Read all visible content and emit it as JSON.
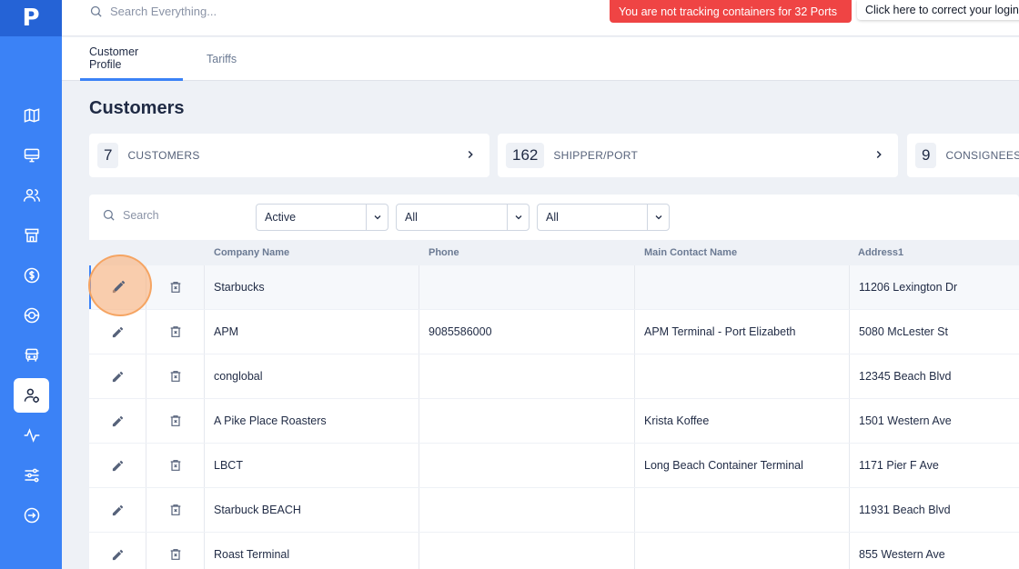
{
  "app": {
    "logo": "P"
  },
  "sidebar": {
    "items": [
      {
        "icon": "map-icon",
        "active": false
      },
      {
        "icon": "monitor-icon",
        "active": false
      },
      {
        "icon": "users-icon",
        "active": false
      },
      {
        "icon": "store-icon",
        "active": false
      },
      {
        "icon": "dollar-icon",
        "active": false
      },
      {
        "icon": "globe-icon",
        "active": false
      },
      {
        "icon": "truck-icon",
        "active": false
      },
      {
        "icon": "user-settings-icon",
        "active": true
      },
      {
        "icon": "activity-icon",
        "active": false
      },
      {
        "icon": "sliders-icon",
        "active": false
      },
      {
        "icon": "logout-icon",
        "active": false
      }
    ]
  },
  "topbar": {
    "search_placeholder": "Search Everything...",
    "alert_text": "You are not tracking containers for 32 Ports",
    "alert_button": "Click here to correct your login",
    "alert_color": "#ef4444"
  },
  "tabs": [
    {
      "label": "Customer Profile",
      "active": true
    },
    {
      "label": "Tariffs",
      "active": false
    }
  ],
  "page": {
    "title": "Customers"
  },
  "summary": [
    {
      "count": "7",
      "label": "CUSTOMERS"
    },
    {
      "count": "162",
      "label": "SHIPPER/PORT"
    },
    {
      "count": "9",
      "label": "CONSIGNEES"
    }
  ],
  "filters": {
    "search_placeholder": "Search",
    "selects": [
      "Active",
      "All",
      "All"
    ]
  },
  "table": {
    "columns": [
      "Company Name",
      "Phone",
      "Main Contact Name",
      "Address1"
    ],
    "rows": [
      {
        "company": "Starbucks",
        "phone": "",
        "contact": "",
        "address": "11206 Lexington Dr"
      },
      {
        "company": "APM",
        "phone": "9085586000",
        "contact": "APM Terminal - Port Elizabeth",
        "address": "5080 McLester St"
      },
      {
        "company": "conglobal",
        "phone": "",
        "contact": "",
        "address": "12345 Beach Blvd"
      },
      {
        "company": "A Pike Place Roasters",
        "phone": "",
        "contact": "Krista Koffee",
        "address": "1501 Western Ave"
      },
      {
        "company": "LBCT",
        "phone": "",
        "contact": "Long Beach Container Terminal",
        "address": "1171 Pier F Ave"
      },
      {
        "company": "Starbuck BEACH",
        "phone": "",
        "contact": "",
        "address": "11931 Beach Blvd"
      },
      {
        "company": "Roast Terminal",
        "phone": "",
        "contact": "",
        "address": "855 Western Ave"
      }
    ]
  },
  "colors": {
    "accent": "#3b82f6",
    "sidebar": "#3b82f6",
    "highlight": "#f5a462"
  }
}
